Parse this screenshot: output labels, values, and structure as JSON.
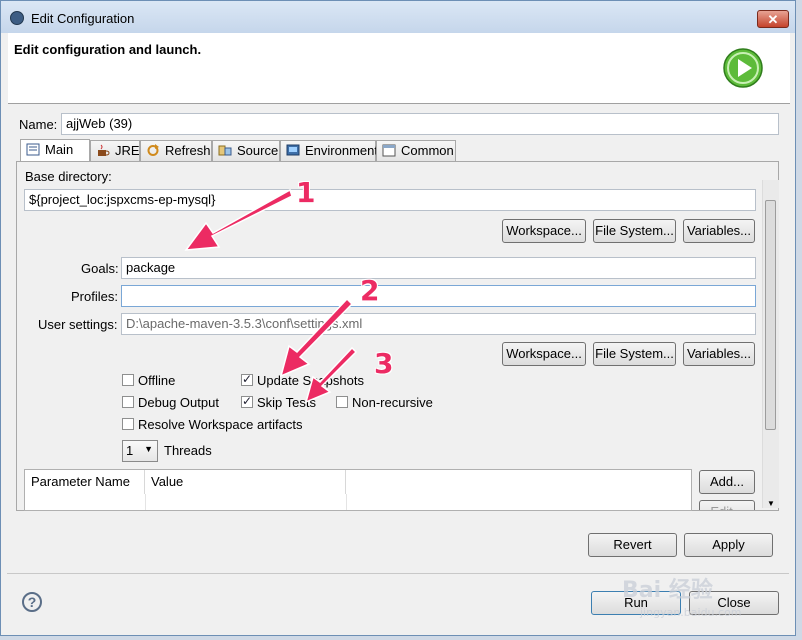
{
  "window": {
    "title": "Edit Configuration"
  },
  "header": {
    "title": "Edit configuration and launch."
  },
  "name_field": {
    "label": "Name:",
    "value": "ajjWeb (39)"
  },
  "tabs": [
    {
      "label": "Main",
      "icon": "main-tab-icon"
    },
    {
      "label": "JRE",
      "icon": "jre-icon"
    },
    {
      "label": "Refresh",
      "icon": "refresh-icon"
    },
    {
      "label": "Source",
      "icon": "source-icon"
    },
    {
      "label": "Environment",
      "icon": "environment-icon"
    },
    {
      "label": "Common",
      "icon": "common-icon"
    }
  ],
  "main": {
    "base_directory_label": "Base directory:",
    "base_directory_value": "${project_loc:jspxcms-ep-mysql}",
    "workspace_btn": "Workspace...",
    "filesystem_btn": "File System...",
    "variables_btn": "Variables...",
    "goals_label": "Goals:",
    "goals_value": "package",
    "profiles_label": "Profiles:",
    "profiles_value": "",
    "user_settings_label": "User settings:",
    "user_settings_value": "D:\\apache-maven-3.5.3\\conf\\settings.xml",
    "checkboxes": {
      "offline": {
        "label": "Offline",
        "checked": false
      },
      "update_snapshots": {
        "label": "Update Snapshots",
        "checked": true
      },
      "debug_output": {
        "label": "Debug Output",
        "checked": false
      },
      "skip_tests": {
        "label": "Skip Tests",
        "checked": true
      },
      "non_recursive": {
        "label": "Non-recursive",
        "checked": false
      },
      "resolve_workspace": {
        "label": "Resolve Workspace artifacts",
        "checked": false
      }
    },
    "threads_value": "1",
    "threads_label": "Threads",
    "table": {
      "columns": [
        "Parameter Name",
        "Value"
      ]
    },
    "add_btn": "Add...",
    "edit_btn": "Edit..."
  },
  "footer": {
    "revert_btn": "Revert",
    "apply_btn": "Apply",
    "run_btn": "Run",
    "close_btn": "Close"
  },
  "annotations": [
    "1",
    "2",
    "3"
  ],
  "watermark": {
    "text": "Bai 经验",
    "subtext": "jingyan.baidu.com"
  },
  "colors": {
    "accent_arrow": "#ec2b63",
    "title_bar": "#c5d6eb",
    "run_icon": "#4caf32"
  }
}
